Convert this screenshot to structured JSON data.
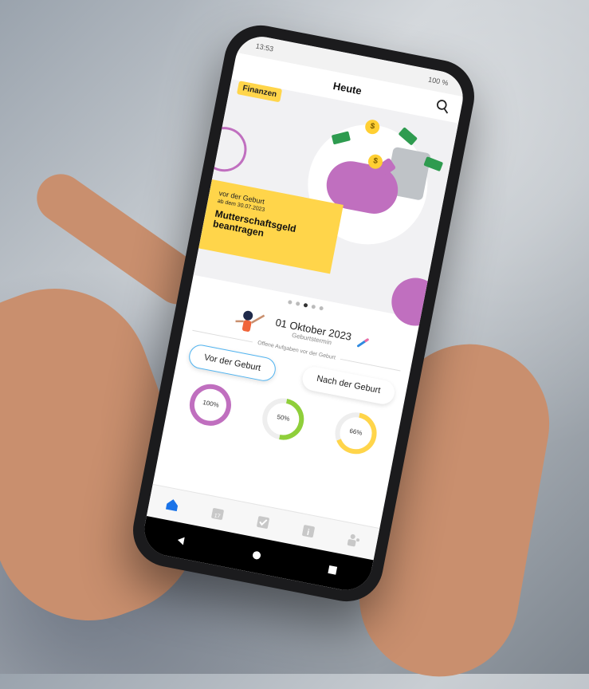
{
  "status_bar": {
    "time": "13:53",
    "battery": "100 %"
  },
  "header": {
    "title": "Heute",
    "search_icon": "search-icon"
  },
  "banner": {
    "tag": "Finanzen",
    "subtitle": "vor der Geburt",
    "date_line": "ab dem 30.07.2023",
    "title": "Mutterschaftsgeld beantragen"
  },
  "carousel": {
    "dots": 5,
    "active_index": 2
  },
  "due_date": {
    "date": "01 Oktober 2023",
    "label": "Geburtstermin"
  },
  "tasks": {
    "heading": "Offene Aufgaben vor der Geburt"
  },
  "tabs": {
    "before": "Vor der Geburt",
    "after": "Nach der Geburt",
    "active": "before"
  },
  "progress": [
    {
      "label": "100%",
      "value": 1.0,
      "color": "#c06fbf"
    },
    {
      "label": "50%",
      "value": 0.5,
      "color": "#8fcf3a"
    },
    {
      "label": "66%",
      "value": 0.66,
      "color": "#ffd54a"
    }
  ],
  "bottom_nav": [
    {
      "icon": "home-icon",
      "active": true
    },
    {
      "icon": "calendar-icon",
      "text": "17"
    },
    {
      "icon": "checklist-icon"
    },
    {
      "icon": "info-icon",
      "text": "i"
    },
    {
      "icon": "people-icon"
    }
  ],
  "colors": {
    "accent": "#1a73e8",
    "yellow": "#ffd54a",
    "purple": "#c06fbf"
  }
}
